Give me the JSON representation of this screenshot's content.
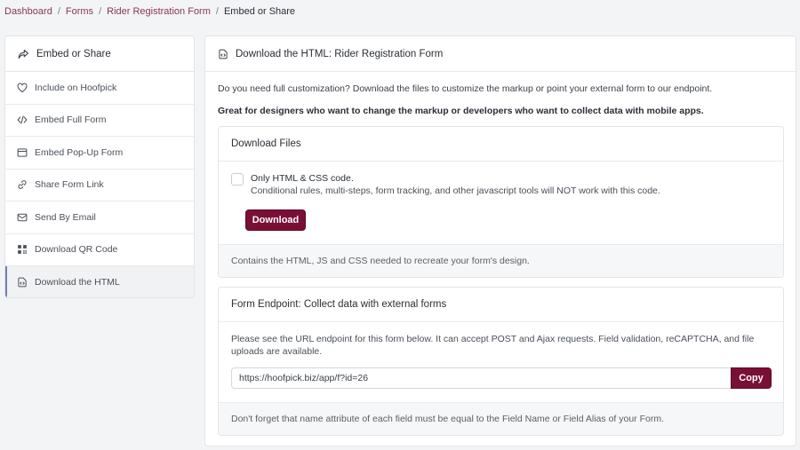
{
  "breadcrumb": {
    "items": [
      "Dashboard",
      "Forms",
      "Rider Registration Form"
    ],
    "current": "Embed or Share",
    "separator": "/"
  },
  "sidebar": {
    "title": "Embed or Share",
    "items": [
      {
        "label": "Include on Hoofpick",
        "icon": "heart-icon"
      },
      {
        "label": "Embed Full Form",
        "icon": "code-icon"
      },
      {
        "label": "Embed Pop-Up Form",
        "icon": "window-icon"
      },
      {
        "label": "Share Form Link",
        "icon": "link-icon"
      },
      {
        "label": "Send By Email",
        "icon": "envelope-icon"
      },
      {
        "label": "Download QR Code",
        "icon": "qr-code-icon"
      },
      {
        "label": "Download the HTML",
        "icon": "file-code-icon",
        "active": true
      }
    ]
  },
  "main": {
    "title": "Download the HTML: Rider Registration Form",
    "intro": "Do you need full customization? Download the files to customize the markup or point your external form to our endpoint.",
    "intro_bold": "Great for designers who want to change the markup or developers who want to collect data with mobile apps."
  },
  "download_card": {
    "title": "Download Files",
    "option_title": "Only HTML & CSS code.",
    "option_desc": "Conditional rules, multi-steps, form tracking, and other javascript tools will NOT work with this code.",
    "button_label": "Download",
    "footer": "Contains the HTML, JS and CSS needed to recreate your form's design."
  },
  "endpoint_card": {
    "title": "Form Endpoint: Collect data with external forms",
    "description": "Please see the URL endpoint for this form below. It can accept POST and Ajax requests. Field validation, reCAPTCHA, and file uploads are available.",
    "url_value": "https://hoofpick.biz/app/f?id=26",
    "copy_label": "Copy",
    "footer": "Don't forget that name attribute of each field must be equal to the Field Name or Field Alias of your Form."
  },
  "colors": {
    "accent": "#7a0f35",
    "link": "#8a3556",
    "active_border": "#6e7fb0"
  }
}
